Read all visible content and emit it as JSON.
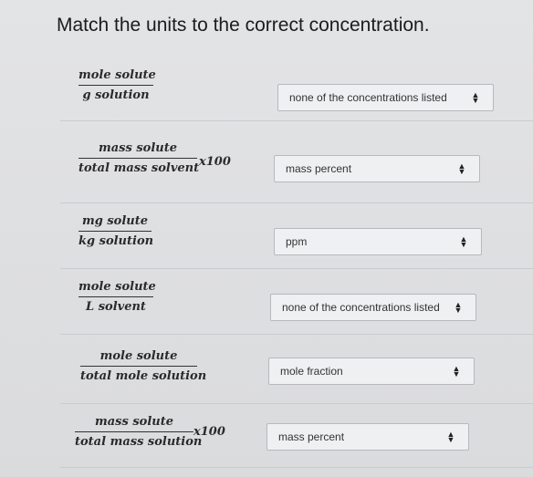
{
  "title": "Match the units to the correct concentration.",
  "rows": [
    {
      "numerator": "mole solute",
      "denominator": "g solution",
      "multiplier": "",
      "selected": "none of the concentrations listed"
    },
    {
      "numerator": "mass solute",
      "denominator": "total mass solvent",
      "multiplier": "x100",
      "selected": "mass percent"
    },
    {
      "numerator": "mg solute",
      "denominator": "kg solution",
      "multiplier": "",
      "selected": "ppm"
    },
    {
      "numerator": "mole solute",
      "denominator": "L solvent",
      "multiplier": "",
      "selected": "none of the concentrations listed"
    },
    {
      "numerator": "mole solute",
      "denominator": "total mole solution",
      "multiplier": "",
      "selected": "mole fraction"
    },
    {
      "numerator": "mass solute",
      "denominator": "total mass solution",
      "multiplier": "x100",
      "selected": "mass percent"
    }
  ],
  "icons": {
    "select_arrow": "up-down-chevron-icon"
  }
}
